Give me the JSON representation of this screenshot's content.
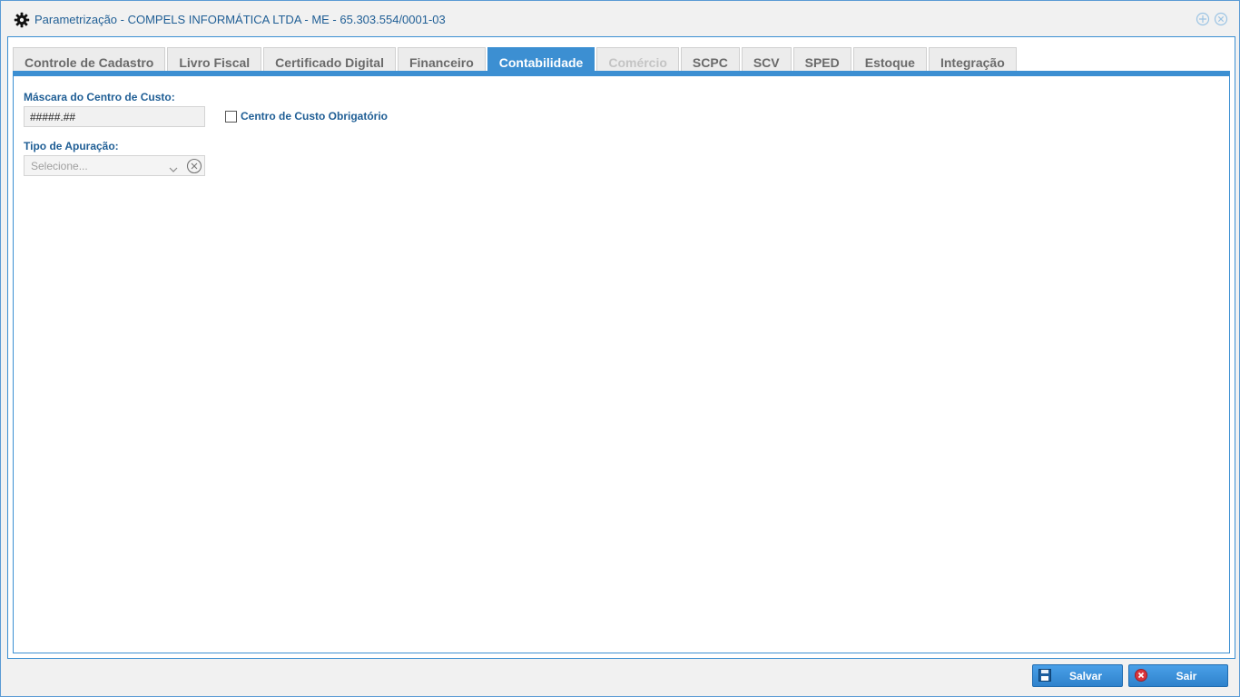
{
  "window": {
    "title": "Parametrização - COMPELS INFORMÁTICA LTDA - ME - 65.303.554/0001-03",
    "icon": "gear-icon"
  },
  "tabs": [
    {
      "label": "Controle de Cadastro",
      "state": "normal"
    },
    {
      "label": "Livro Fiscal",
      "state": "normal"
    },
    {
      "label": "Certificado Digital",
      "state": "normal"
    },
    {
      "label": "Financeiro",
      "state": "normal"
    },
    {
      "label": "Contabilidade",
      "state": "active"
    },
    {
      "label": "Comércio",
      "state": "disabled"
    },
    {
      "label": "SCPC",
      "state": "normal"
    },
    {
      "label": "SCV",
      "state": "normal"
    },
    {
      "label": "SPED",
      "state": "normal"
    },
    {
      "label": "Estoque",
      "state": "normal"
    },
    {
      "label": "Integração",
      "state": "normal"
    }
  ],
  "form": {
    "mask_label": "Máscara do Centro de Custo:",
    "mask_value": "#####.##",
    "required_label": "Centro de Custo Obrigatório",
    "required_checked": false,
    "apuracao_label": "Tipo de Apuração:",
    "apuracao_placeholder": "Selecione..."
  },
  "footer": {
    "save_label": "Salvar",
    "exit_label": "Sair"
  },
  "colors": {
    "accent": "#3c8fd2",
    "label_text": "#1f5e95"
  }
}
